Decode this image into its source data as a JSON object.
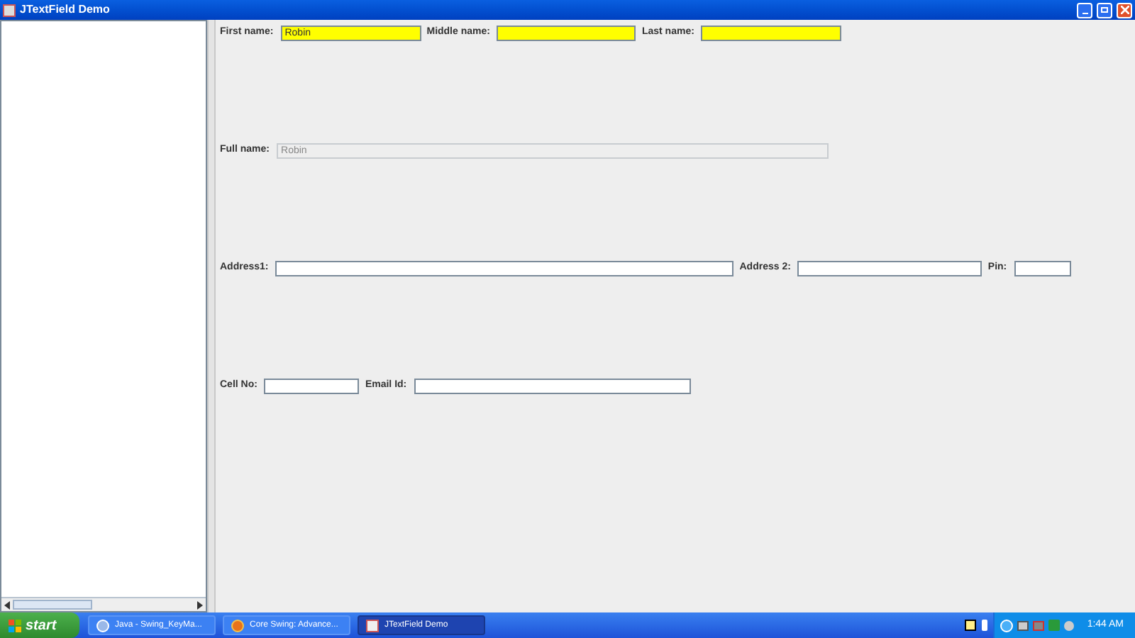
{
  "window": {
    "title": "JTextField Demo"
  },
  "form_rows": [
    {
      "fields": [
        {
          "label": "First name:",
          "value": "Robin",
          "highlighted": true,
          "editable": true
        },
        {
          "label": "Middle name:",
          "highlighted": true,
          "editable": true
        },
        {
          "label": "Last name:",
          "highlighted": true,
          "editable": true
        }
      ]
    },
    {
      "fields": [
        {
          "label": "Full name:",
          "value": "Robin",
          "highlighted": false,
          "editable": false
        }
      ]
    },
    {
      "fields": [
        {
          "label": "Address1:",
          "highlighted": false,
          "editable": true
        },
        {
          "label": "Address 2:",
          "highlighted": false,
          "editable": true
        },
        {
          "label": "Pin:",
          "highlighted": false,
          "editable": true
        }
      ]
    },
    {
      "fields": [
        {
          "label": "Cell No:",
          "highlighted": false,
          "editable": true
        },
        {
          "label": "Email Id:",
          "highlighted": false,
          "editable": true
        }
      ]
    }
  ],
  "taskbar": {
    "start": "start",
    "tasks": [
      {
        "kind": "browser",
        "label": "Java - Swing_KeyMa...",
        "selected": false
      },
      {
        "kind": "firefox",
        "label": "Core Swing: Advance...",
        "selected": false
      },
      {
        "kind": "java",
        "label": "JTextField Demo",
        "selected": true
      }
    ],
    "clock": "1:44 AM"
  }
}
